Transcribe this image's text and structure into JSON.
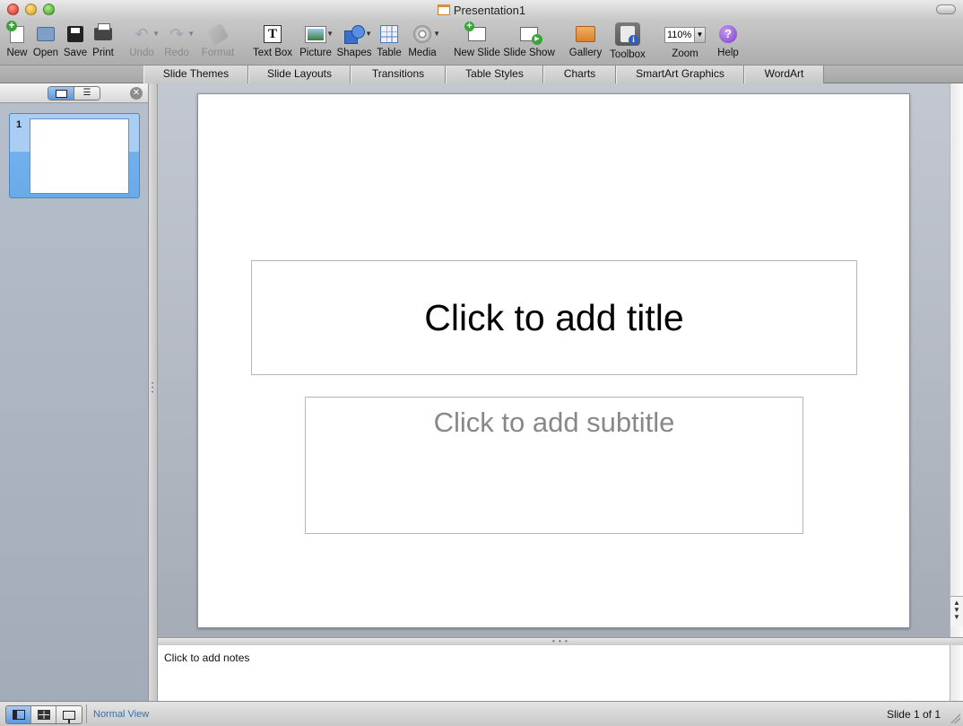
{
  "window": {
    "title": "Presentation1"
  },
  "toolbar": {
    "new": "New",
    "open": "Open",
    "save": "Save",
    "print": "Print",
    "undo": "Undo",
    "redo": "Redo",
    "format": "Format",
    "text_box": "Text Box",
    "picture": "Picture",
    "shapes": "Shapes",
    "table": "Table",
    "media": "Media",
    "new_slide": "New Slide",
    "slide_show": "Slide Show",
    "gallery": "Gallery",
    "toolbox": "Toolbox",
    "zoom": "Zoom",
    "zoom_value": "110%",
    "help": "Help"
  },
  "ribbon": {
    "tabs": [
      "Slide Themes",
      "Slide Layouts",
      "Transitions",
      "Table Styles",
      "Charts",
      "SmartArt Graphics",
      "WordArt"
    ]
  },
  "slides_panel": {
    "thumb_number": "1"
  },
  "slide": {
    "title_placeholder": "Click to add title",
    "subtitle_placeholder": "Click to add subtitle"
  },
  "notes": {
    "placeholder": "Click to add notes"
  },
  "status": {
    "view_name": "Normal View",
    "slide_indicator": "Slide 1 of 1"
  },
  "colors": {
    "slide_bg": "#ffffff",
    "subtitle_text": "#888888",
    "status_view_text": "#3a6da8",
    "selection_blue": "#6aaaea"
  }
}
